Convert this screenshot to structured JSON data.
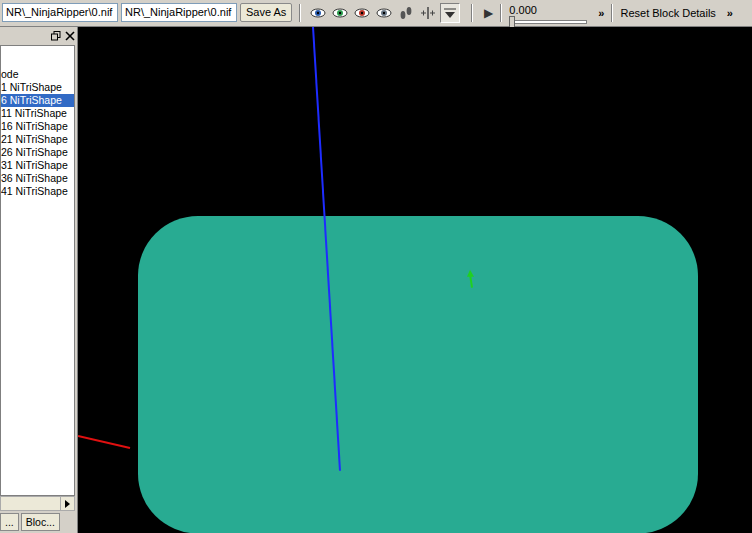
{
  "toolbar": {
    "files": [
      "NR\\_NinjaRipper\\0.nif",
      "NR\\_NinjaRipper\\0.nif"
    ],
    "save_button": "Save As",
    "view_buttons": [
      {
        "kind": "eye",
        "color": "#2a5db0",
        "pressed": false
      },
      {
        "kind": "eye",
        "color": "#2e9e4f",
        "pressed": false
      },
      {
        "kind": "eye",
        "color": "#c0392b",
        "pressed": false
      },
      {
        "kind": "eye",
        "color": "#6c7a89",
        "pressed": false
      },
      {
        "kind": "footprints",
        "color": "#555555",
        "pressed": false
      },
      {
        "kind": "axes",
        "color": "#444444",
        "pressed": false
      },
      {
        "kind": "arrow",
        "color": "#333333",
        "pressed": true
      }
    ],
    "play": "▶",
    "time": "0.000",
    "time_slider": {
      "level": 0
    },
    "more_left": "»",
    "reset_button": "Reset Block Details",
    "more_right": "»"
  },
  "block_list": {
    "header": "ode",
    "items": [
      {
        "label": "1 NiTriShape",
        "selected": false
      },
      {
        "label": "6 NiTriShape",
        "selected": true
      },
      {
        "label": "11 NiTriShape",
        "selected": false
      },
      {
        "label": "16 NiTriShape",
        "selected": false
      },
      {
        "label": "21 NiTriShape",
        "selected": false
      },
      {
        "label": "26 NiTriShape",
        "selected": false
      },
      {
        "label": "31 NiTriShape",
        "selected": false
      },
      {
        "label": "36 NiTriShape",
        "selected": false
      },
      {
        "label": "41 NiTriShape",
        "selected": false
      }
    ],
    "buttons": [
      "...",
      "Bloc..."
    ]
  }
}
